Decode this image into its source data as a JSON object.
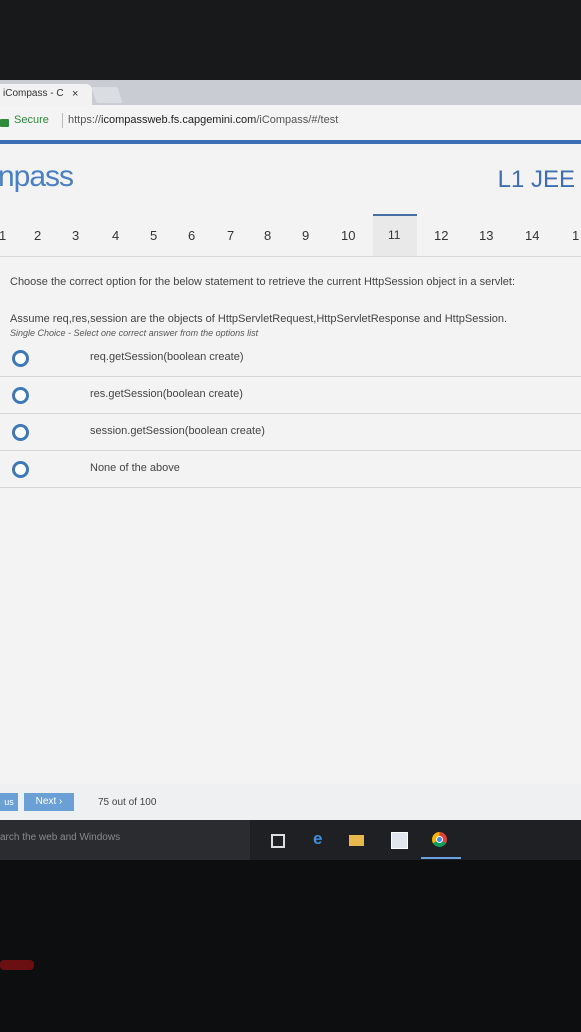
{
  "browser": {
    "tab_title": "iCompass - C",
    "tab_close": "×",
    "secure_label": "Secure",
    "url_scheme": "https://",
    "url_domain": "icompassweb.fs.capgemini.com",
    "url_path": "/iCompass/#/test"
  },
  "header": {
    "logo_text": "npass",
    "course": "L1 JEE"
  },
  "question_numbers": [
    "1",
    "2",
    "3",
    "4",
    "5",
    "6",
    "7",
    "8",
    "9",
    "10",
    "11",
    "12",
    "13",
    "14",
    "1"
  ],
  "active_question": "11",
  "question": {
    "text": "Choose the correct option for the below statement to retrieve the current HttpSession object in a servlet:",
    "assumption": "Assume req,res,session are the objects of HttpServletRequest,HttpServletResponse and HttpSession.",
    "hint": "Single Choice - Select one correct answer from the options list"
  },
  "options": [
    {
      "label": "req.getSession(boolean create)"
    },
    {
      "label": "res.getSession(boolean create)"
    },
    {
      "label": "session.getSession(boolean create)"
    },
    {
      "label": "None of the above"
    }
  ],
  "footer": {
    "prev_label": "us",
    "next_label": "Next ›",
    "progress_text": "75 out of 100"
  },
  "taskbar": {
    "search_placeholder": "arch the web and Windows"
  },
  "colors": {
    "accent": "#3c6fb5",
    "radio": "#3d79b8",
    "button": "#6aa0d6",
    "secure": "#2d8a38"
  }
}
